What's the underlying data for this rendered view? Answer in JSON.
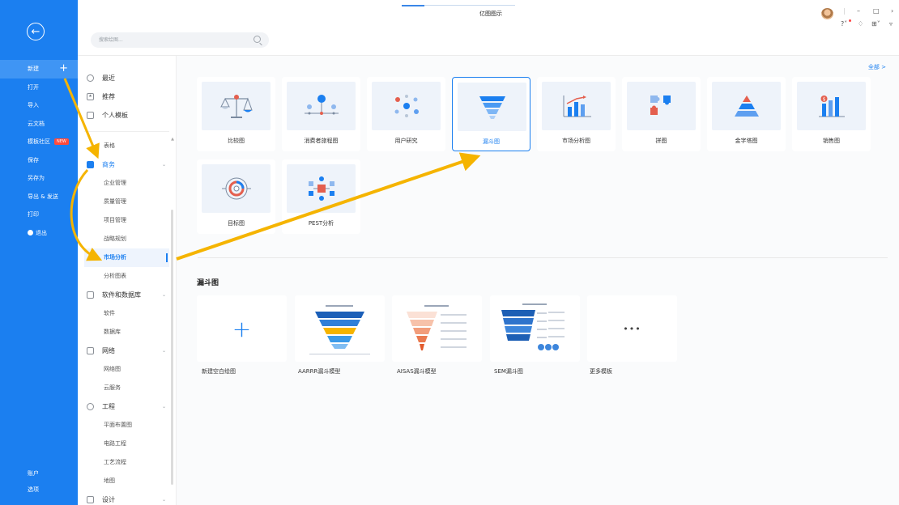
{
  "window": {
    "title": "亿图图示"
  },
  "left_menu": {
    "items": [
      {
        "label": "新建",
        "plus": "+"
      },
      {
        "label": "打开"
      },
      {
        "label": "导入"
      },
      {
        "label": "云文档"
      },
      {
        "label": "模板社区",
        "badge": "NEW"
      },
      {
        "label": "保存"
      },
      {
        "label": "另存为"
      },
      {
        "label": "导出 & 发送"
      },
      {
        "label": "打印"
      },
      {
        "label": "退出"
      }
    ],
    "bottom": [
      {
        "label": "账户"
      },
      {
        "label": "选项"
      }
    ]
  },
  "search": {
    "placeholder": "搜索绘图..."
  },
  "categories": {
    "top": [
      {
        "label": "最近",
        "icon": "clock-icon"
      },
      {
        "label": "推荐",
        "icon": "star-icon"
      },
      {
        "label": "个人模板",
        "icon": "template-icon"
      }
    ],
    "first_visible": "表格",
    "business": {
      "label": "商务",
      "chev": "⌄"
    },
    "business_subs": [
      "企业管理",
      "质量管理",
      "项目管理",
      "战略规划",
      "市场分析",
      "分析图表"
    ],
    "software": {
      "label": "软件和数据库",
      "chev": "⌄"
    },
    "software_subs": [
      "软件",
      "数据库"
    ],
    "network": {
      "label": "网络",
      "chev": "⌄"
    },
    "network_subs": [
      "网络图",
      "云服务"
    ],
    "engineering": {
      "label": "工程",
      "chev": "⌄"
    },
    "engineering_subs": [
      "平面布置图",
      "电路工程",
      "工艺流程",
      "地图"
    ],
    "design": {
      "label": "设计",
      "chev": "⌄"
    }
  },
  "content": {
    "all_link": "全部 >",
    "cards": [
      "比较图",
      "消费者旅程图",
      "用户研究",
      "漏斗图",
      "市场分析图",
      "拼图",
      "金字塔图",
      "销售图",
      "目标图",
      "PEST分析"
    ],
    "section_title": "漏斗图",
    "templates": [
      "新建空白绘图",
      "AARRR漏斗模型",
      "AISAS漏斗模型",
      "SEM漏斗图",
      "更多模板"
    ],
    "more_dots": "•••",
    "blank_plus": "+"
  },
  "colors": {
    "brand": "#1b7ff0",
    "arrow": "#f5b400"
  }
}
